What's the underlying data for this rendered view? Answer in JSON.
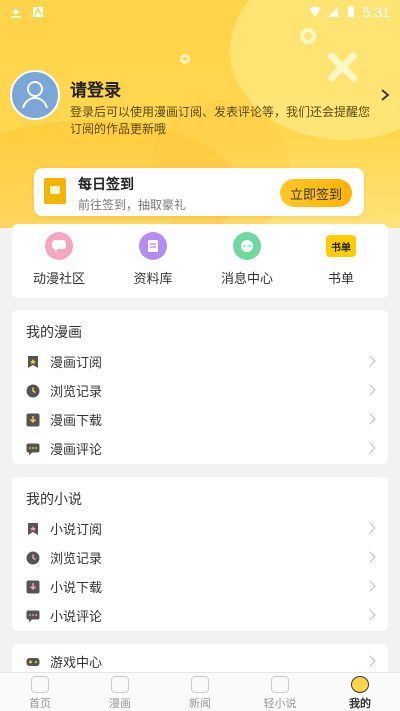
{
  "status_bar": {
    "time": "5:31"
  },
  "profile": {
    "title": "请登录",
    "description": "登录后可以使用漫画订阅、发表评论等，我们还会提醒您订阅的作品更新哦"
  },
  "sign_in": {
    "title": "每日签到",
    "subtitle": "前往签到，抽取豪礼",
    "button": "立即签到"
  },
  "quick_menu": [
    {
      "label": "动漫社区",
      "icon": "community-icon",
      "color": "#f7a6c0"
    },
    {
      "label": "资料库",
      "icon": "library-icon",
      "color": "#b58cf0"
    },
    {
      "label": "消息中心",
      "icon": "message-icon",
      "color": "#6fd9a0"
    },
    {
      "label": "书单",
      "icon": "booklist-icon",
      "color": "#ffcc00",
      "text": "书单"
    }
  ],
  "comic_section": {
    "title": "我的漫画",
    "items": [
      {
        "label": "漫画订阅",
        "icon": "bookmark-icon"
      },
      {
        "label": "浏览记录",
        "icon": "history-icon"
      },
      {
        "label": "漫画下载",
        "icon": "download-icon"
      },
      {
        "label": "漫画评论",
        "icon": "comment-icon"
      }
    ]
  },
  "novel_section": {
    "title": "我的小说",
    "items": [
      {
        "label": "小说订阅",
        "icon": "bookmark-icon"
      },
      {
        "label": "浏览记录",
        "icon": "history-icon"
      },
      {
        "label": "小说下载",
        "icon": "download-icon"
      },
      {
        "label": "小说评论",
        "icon": "comment-icon"
      }
    ]
  },
  "game_section": {
    "items": [
      {
        "label": "游戏中心",
        "icon": "game-icon"
      }
    ]
  },
  "bottom_nav": {
    "items": [
      {
        "label": "首页",
        "icon": "home-icon"
      },
      {
        "label": "漫画",
        "icon": "comic-icon"
      },
      {
        "label": "新闻",
        "icon": "news-icon"
      },
      {
        "label": "轻小说",
        "icon": "novel-icon"
      },
      {
        "label": "我的",
        "icon": "profile-icon",
        "active": true
      }
    ]
  },
  "colors": {
    "brand_yellow": "#ffd34a",
    "button_yellow": "#ffb300",
    "icon_dark": "#555555"
  }
}
